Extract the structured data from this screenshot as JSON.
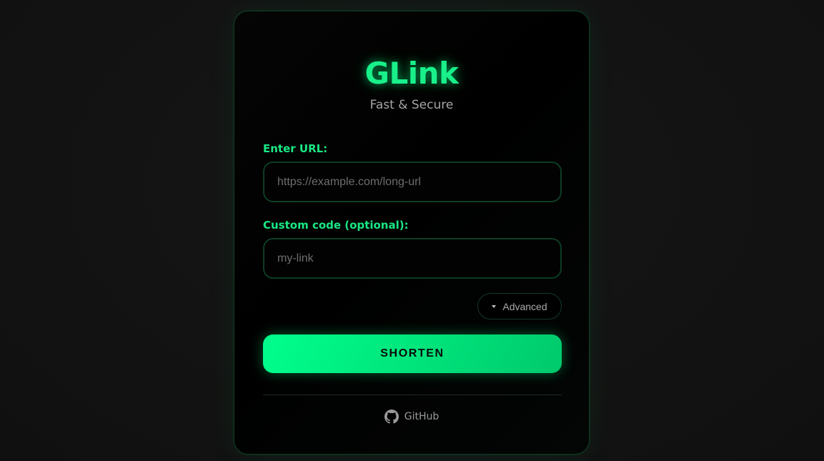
{
  "app": {
    "title": "GLink",
    "subtitle": "Fast & Secure"
  },
  "form": {
    "url_label": "Enter URL:",
    "url_placeholder": "https://example.com/long-url",
    "url_value": "",
    "code_label": "Custom code (optional):",
    "code_placeholder": "my-link",
    "code_value": "",
    "advanced_label": "Advanced",
    "submit_label": "SHORTEN"
  },
  "footer": {
    "github_label": "GitHub",
    "github_icon": "github-icon"
  },
  "colors": {
    "accent": "#19f08a",
    "button_gradient_start": "#00ff8c",
    "button_gradient_end": "#00c96c",
    "background": "#141414",
    "card_background": "#000000"
  }
}
